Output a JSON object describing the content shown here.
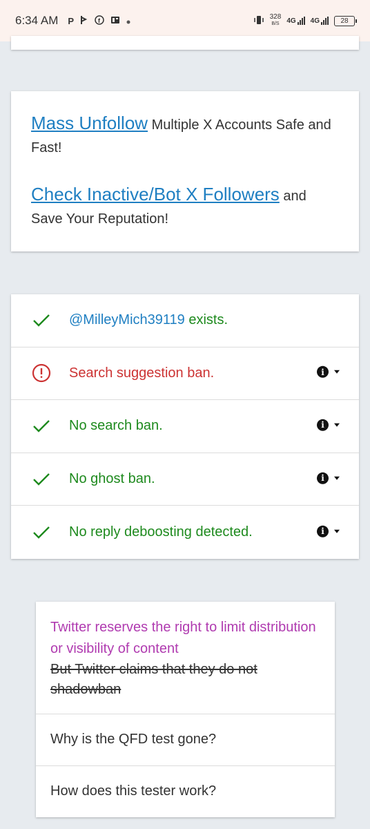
{
  "status_bar": {
    "time": "6:34 AM",
    "notification_icons": [
      "P",
      "pinterest-icon",
      "facebook-icon",
      "news-icon",
      "dot-icon"
    ],
    "speed_value": "328",
    "speed_unit": "B/S",
    "network1": "4G",
    "network2": "4G",
    "battery": "28"
  },
  "promo": {
    "link1": "Mass Unfollow",
    "text1": " Multiple X Accounts Safe and Fast!",
    "link2": "Check Inactive/Bot X Followers",
    "text2": " and Save Your Reputation!"
  },
  "results": [
    {
      "status": "ok",
      "username": "@MilleyMich39119",
      "text": " exists.",
      "has_info": false
    },
    {
      "status": "bad",
      "text": "Search suggestion ban.",
      "has_info": true
    },
    {
      "status": "ok",
      "text": "No search ban.",
      "has_info": true
    },
    {
      "status": "ok",
      "text": "No ghost ban.",
      "has_info": true
    },
    {
      "status": "ok",
      "text": "No reply deboosting detected.",
      "has_info": true
    }
  ],
  "faq": {
    "notice": "Twitter reserves the right to limit distribution or visibility of content",
    "notice_strike": "But Twitter claims that they do not shadowban",
    "q1": "Why is the QFD test gone?",
    "q2": "How does this tester work?"
  },
  "colors": {
    "ok": "#1e8a1e",
    "bad": "#cc3333",
    "link": "#1f7fc2",
    "purple": "#b03bb0"
  }
}
